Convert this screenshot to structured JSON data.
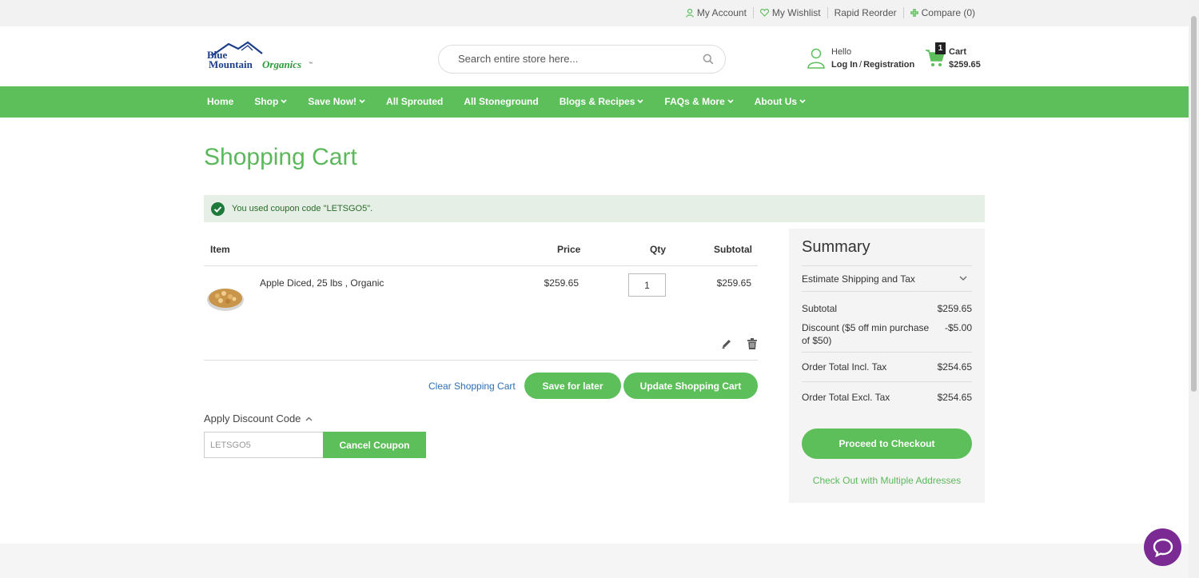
{
  "toplinks": {
    "account": "My Account",
    "wishlist": "My Wishlist",
    "reorder": "Rapid Reorder",
    "compare": "Compare (0)"
  },
  "brand": {
    "logo_line1": "Blue",
    "logo_line2": "Mountain",
    "logo_line3": "Organics",
    "accent": "#5cbf5a"
  },
  "search": {
    "placeholder": "Search entire store here..."
  },
  "account": {
    "hello": "Hello",
    "login": "Log In",
    "separator": "/",
    "register": "Registration"
  },
  "cart": {
    "count": "1",
    "label": "Cart",
    "total": "$259.65"
  },
  "nav": [
    "Home",
    "Shop",
    "Save Now!",
    "All Sprouted",
    "All Stoneground",
    "Blogs & Recipes",
    "FAQs & More",
    "About Us"
  ],
  "page": {
    "title": "Shopping Cart"
  },
  "message": {
    "text": "You used coupon code \"LETSGO5\"."
  },
  "table": {
    "headers": {
      "item": "Item",
      "price": "Price",
      "qty": "Qty",
      "subtotal": "Subtotal"
    },
    "rows": [
      {
        "name": "Apple Diced, 25 lbs , Organic",
        "price": "$259.65",
        "qty": "1",
        "subtotal": "$259.65"
      }
    ]
  },
  "actions": {
    "clear": "Clear Shopping Cart",
    "save": "Save for later",
    "update": "Update Shopping Cart"
  },
  "discount": {
    "title": "Apply Discount Code",
    "code": "LETSGO5",
    "cancel": "Cancel Coupon"
  },
  "summary": {
    "title": "Summary",
    "estimate": "Estimate Shipping and Tax",
    "subtotal_label": "Subtotal",
    "subtotal_value": "$259.65",
    "discount_label": "Discount ($5 off min purchase of $50)",
    "discount_value": "-$5.00",
    "incl_label": "Order Total Incl. Tax",
    "incl_value": "$254.65",
    "excl_label": "Order Total Excl. Tax",
    "excl_value": "$254.65",
    "checkout": "Proceed to Checkout",
    "multi": "Check Out with Multiple Addresses"
  }
}
